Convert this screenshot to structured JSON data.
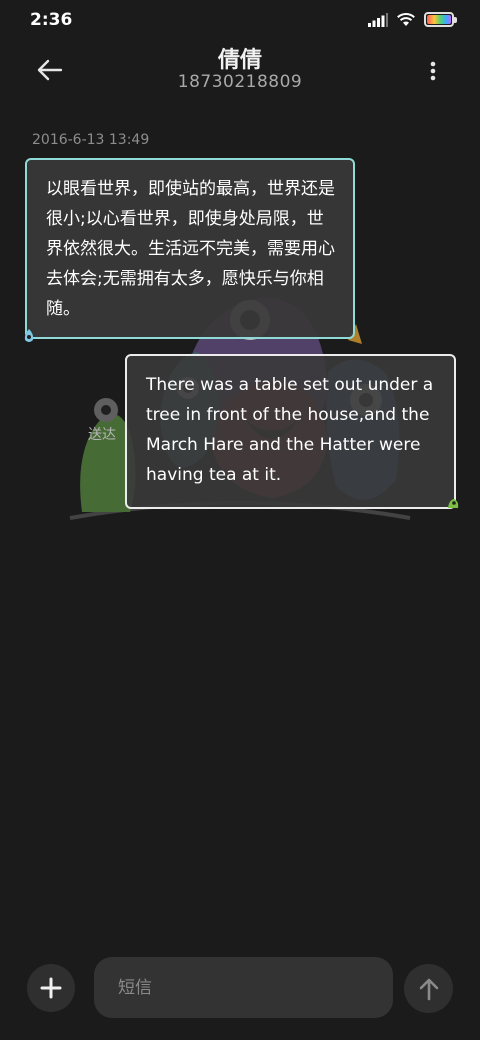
{
  "status_bar": {
    "time": "2:36",
    "icons": [
      "signal-icon",
      "wifi-icon",
      "battery-icon"
    ]
  },
  "header": {
    "contact_name": "倩倩",
    "contact_number": "18730218809",
    "back_icon": "back-arrow-icon",
    "more_icon": "more-vertical-icon"
  },
  "conversation": {
    "timestamp": "2016-6-13 13:49",
    "messages": [
      {
        "direction": "received",
        "text": "以眼看世界，即使站的最高，世界还是很小;以心看世界，即使身处局限，世界依然很大。生活远不完美，需要用心去体会;无需拥有太多，愿快乐与你相随。",
        "border_color": "#8fd9d6"
      },
      {
        "direction": "sent",
        "text": "There was a table set out under a tree in front of the house,and the March Hare and the Hatter were having tea at it.",
        "status": "送达",
        "border_color": "#ececec"
      }
    ]
  },
  "compose": {
    "placeholder": "短信",
    "value": "",
    "add_icon": "plus-icon",
    "send_icon": "arrow-up-icon"
  },
  "colors": {
    "background": "#1b1b1b",
    "bubble": "#383838",
    "received_border": "#8fd9d6",
    "sent_border": "#ececec",
    "control": "#2f2f2f"
  }
}
